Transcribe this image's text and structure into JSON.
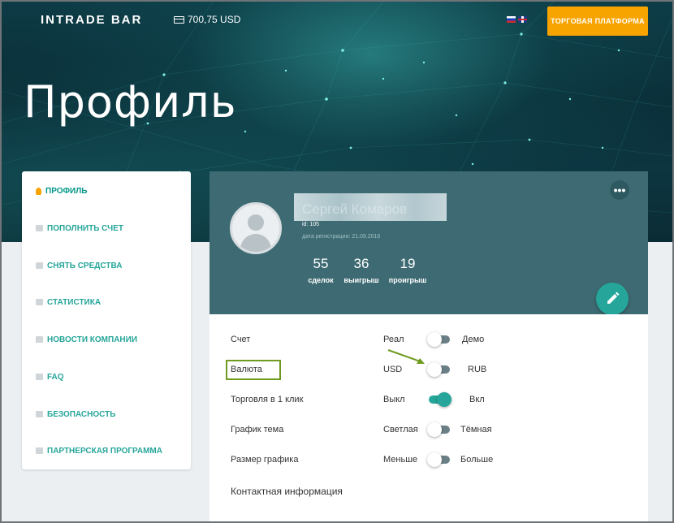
{
  "header": {
    "logo": "INTRADE BAR",
    "balance": "700,75 USD",
    "trade_button": "ТОРГОВАЯ ПЛАТФОРМА"
  },
  "page_title": "Профиль",
  "sidebar": {
    "items": [
      {
        "label": "ПРОФИЛЬ",
        "icon": "user-icon",
        "active": true
      },
      {
        "label": "ПОПОЛНИТЬ СЧЕТ",
        "icon": "cart-icon"
      },
      {
        "label": "СНЯТЬ СРЕДСТВА",
        "icon": "withdraw-icon"
      },
      {
        "label": "СТАТИСТИКА",
        "icon": "bar-chart-icon"
      },
      {
        "label": "НОВОСТИ КОМПАНИИ",
        "icon": "news-icon"
      },
      {
        "label": "FAQ",
        "icon": "keyboard-icon"
      },
      {
        "label": "БЕЗОПАСНОСТЬ",
        "icon": "lock-icon"
      },
      {
        "label": "ПАРТНЕРСКАЯ ПРОГРАММА",
        "icon": "partners-icon"
      }
    ]
  },
  "profile": {
    "name": "Сергей Комаров",
    "id": "id: 105",
    "registered": "дата регистрации: 21.09.2016",
    "stats": [
      {
        "value": "55",
        "label": "сделок"
      },
      {
        "value": "36",
        "label": "выигрыш"
      },
      {
        "value": "19",
        "label": "проигрыш"
      }
    ]
  },
  "settings": [
    {
      "label": "Счет",
      "left": "Реал",
      "right": "Демо",
      "on": false
    },
    {
      "label": "Валюта",
      "left": "USD",
      "right": "RUB",
      "on": false
    },
    {
      "label": "Торговля в 1 клик",
      "left": "Выкл",
      "right": "Вкл",
      "on": true
    },
    {
      "label": "График тема",
      "left": "Светлая",
      "right": "Тёмная",
      "on": false
    },
    {
      "label": "Размер графика",
      "left": "Меньше",
      "right": "Больше",
      "on": false
    }
  ],
  "contact_title": "Контактная информация",
  "colors": {
    "accent": "#26a69a",
    "orange": "#f7a300",
    "card_header": "#3e6b73",
    "highlight": "#6f9a1f"
  }
}
